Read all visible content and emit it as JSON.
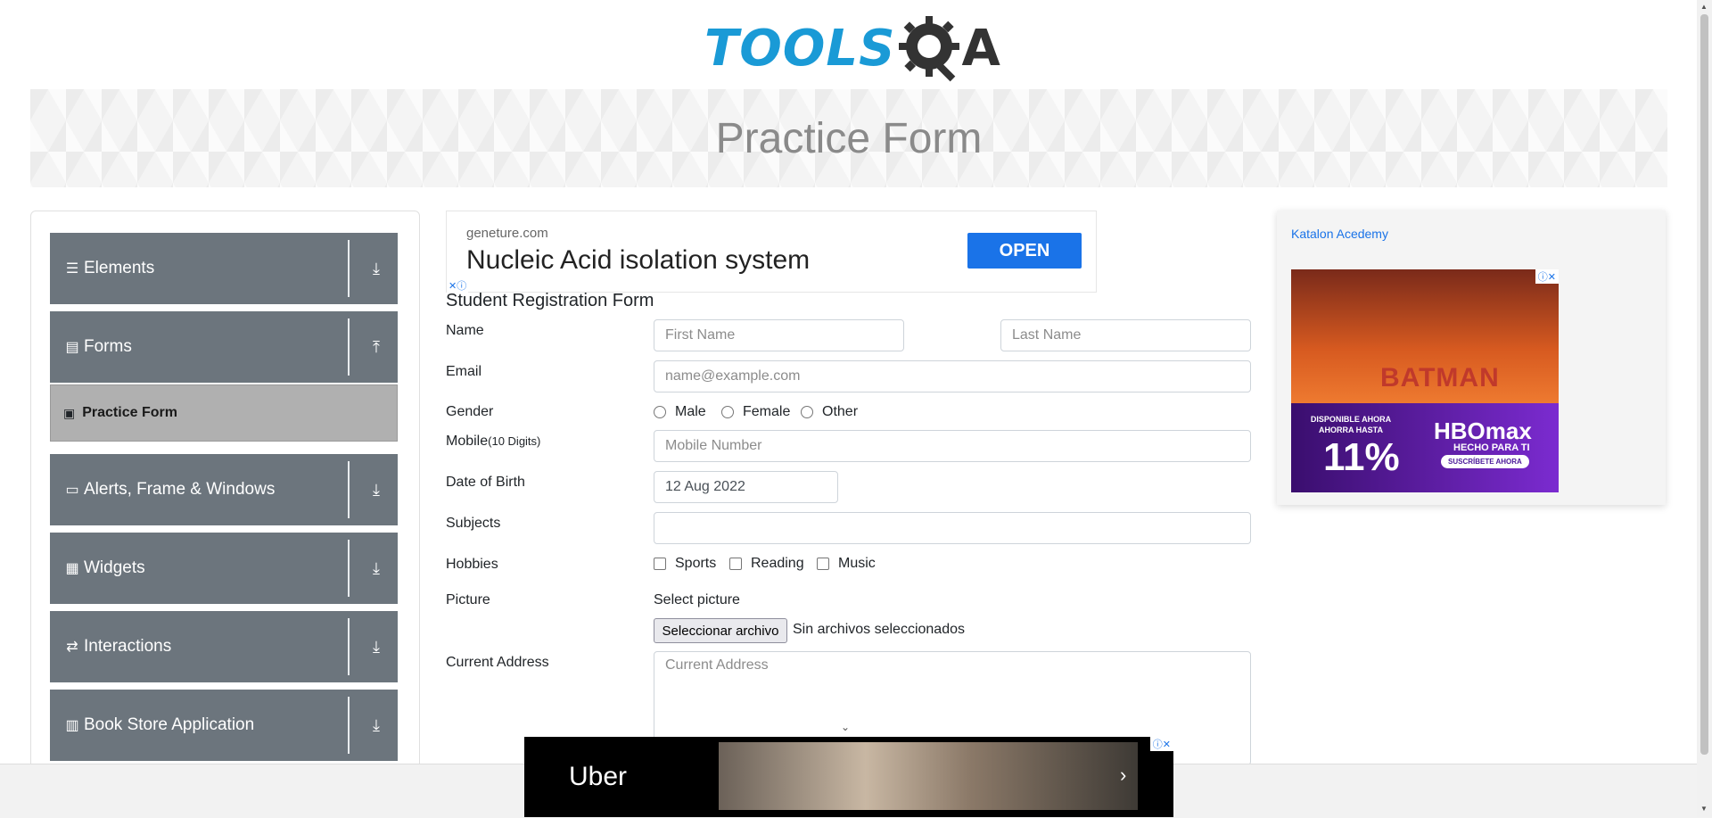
{
  "header": {
    "logo_text_tools": "TOOLS",
    "logo_text_a": "A",
    "page_title": "Practice Form"
  },
  "sidebar": {
    "groups": [
      {
        "label": "Elements",
        "icon": "hamburger-icon",
        "arrow": "download-arrow-icon"
      },
      {
        "label": "Forms",
        "icon": "file-icon",
        "arrow": "upload-arrow-icon"
      },
      {
        "label": "Alerts, Frame & Windows",
        "icon": "window-icon",
        "arrow": "download-arrow-icon"
      },
      {
        "label": "Widgets",
        "icon": "widgets-icon",
        "arrow": "download-arrow-icon"
      },
      {
        "label": "Interactions",
        "icon": "interactions-icon",
        "arrow": "download-arrow-icon"
      },
      {
        "label": "Book Store Application",
        "icon": "books-icon",
        "arrow": "download-arrow-icon"
      }
    ],
    "active_item": "Practice Form"
  },
  "ad_top": {
    "domain": "geneture.com",
    "headline": "Nucleic Acid isolation system",
    "button": "OPEN"
  },
  "form": {
    "title": "Student Registration Form",
    "name_label": "Name",
    "first_name_placeholder": "First Name",
    "last_name_placeholder": "Last Name",
    "email_label": "Email",
    "email_placeholder": "name@example.com",
    "gender_label": "Gender",
    "gender_options": [
      "Male",
      "Female",
      "Other"
    ],
    "mobile_label": "Mobile",
    "mobile_hint": "(10 Digits)",
    "mobile_placeholder": "Mobile Number",
    "dob_label": "Date of Birth",
    "dob_value": "12 Aug 2022",
    "subjects_label": "Subjects",
    "hobbies_label": "Hobbies",
    "hobbies_options": [
      "Sports",
      "Reading",
      "Music"
    ],
    "picture_label": "Picture",
    "select_picture": "Select picture",
    "file_button": "Seleccionar archivo",
    "file_status": "Sin archivos seleccionados",
    "address_label": "Current Address",
    "address_placeholder": "Current Address"
  },
  "ad_right": {
    "katalon_alt": "Katalon Acedemy",
    "movie_title": "BATMAN",
    "disponible": "DISPONIBLE AHORA AHORRA HASTA",
    "percent": "11%",
    "brand": "HBOmax",
    "slogan": "HECHO PARA TI",
    "cta": "SUSCRÍBETE AHORA"
  },
  "ad_bottom": {
    "brand": "Uber"
  },
  "colors": {
    "sidebar_group": "#6c757d",
    "active_item": "#b0b0b0",
    "accent_blue": "#1a73e8",
    "logo_blue": "#1a9ad6"
  }
}
